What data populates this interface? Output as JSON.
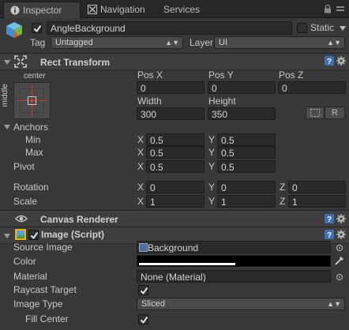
{
  "tabs": [
    {
      "label": "Inspector",
      "icon": "info-icon"
    },
    {
      "label": "Navigation",
      "icon": "navigation-icon"
    },
    {
      "label": "Services",
      "icon": ""
    }
  ],
  "object": {
    "name": "AngleBackground",
    "active": true,
    "static_label": "Static",
    "static_checked": false,
    "tag_label": "Tag",
    "tag_value": "Untagged",
    "layer_label": "Layer",
    "layer_value": "UI"
  },
  "rect_transform": {
    "title": "Rect Transform",
    "anchor_preset_h": "center",
    "anchor_preset_v": "middle",
    "pos_x_label": "Pos X",
    "pos_x": "0",
    "pos_y_label": "Pos Y",
    "pos_y": "0",
    "pos_z_label": "Pos Z",
    "pos_z": "0",
    "width_label": "Width",
    "width": "300",
    "height_label": "Height",
    "height": "350",
    "r_button": "R",
    "anchors_label": "Anchors",
    "min_label": "Min",
    "min_x": "0.5",
    "min_y": "0.5",
    "max_label": "Max",
    "max_x": "0.5",
    "max_y": "0.5",
    "pivot_label": "Pivot",
    "pivot_x": "0.5",
    "pivot_y": "0.5",
    "rotation_label": "Rotation",
    "rot_x": "0",
    "rot_y": "0",
    "rot_z": "0",
    "scale_label": "Scale",
    "scale_x": "1",
    "scale_y": "1",
    "scale_z": "1",
    "x": "X",
    "y": "Y",
    "z": "Z"
  },
  "canvas_renderer": {
    "title": "Canvas Renderer"
  },
  "image": {
    "title": "Image (Script)",
    "enabled": true,
    "source_image_label": "Source Image",
    "source_image": "Background",
    "color_label": "Color",
    "material_label": "Material",
    "material": "None (Material)",
    "raycast_label": "Raycast Target",
    "raycast_checked": true,
    "image_type_label": "Image Type",
    "image_type": "Sliced",
    "fill_center_label": "Fill Center",
    "fill_center_checked": true
  },
  "colors": {
    "background": "#383838",
    "field": "#2a2a2a",
    "accent_blue": "#3d6fb6"
  }
}
